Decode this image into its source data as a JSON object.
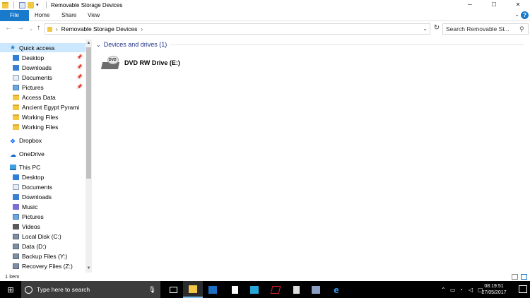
{
  "window": {
    "title": "Removable Storage Devices",
    "controls": {
      "minimize": "─",
      "maximize": "☐",
      "close": "✕"
    }
  },
  "ribbon": {
    "tabs": [
      "File",
      "Home",
      "Share",
      "View"
    ],
    "help": "?"
  },
  "navbar": {
    "back": "←",
    "forward": "→",
    "recent": "⌄",
    "up": "↑",
    "breadcrumb": "Removable Storage Devices",
    "search_placeholder": "Search Removable St..."
  },
  "sidebar": {
    "quick_access": "Quick access",
    "quick_items": [
      {
        "label": "Desktop",
        "pinned": true
      },
      {
        "label": "Downloads",
        "pinned": true
      },
      {
        "label": "Documents",
        "pinned": true
      },
      {
        "label": "Pictures",
        "pinned": true
      },
      {
        "label": "Access Data"
      },
      {
        "label": "Ancient Egypt Pyrami"
      },
      {
        "label": "Working Files"
      },
      {
        "label": "Working Files"
      }
    ],
    "dropbox": "Dropbox",
    "onedrive": "OneDrive",
    "this_pc": "This PC",
    "pc_items": [
      "Desktop",
      "Documents",
      "Downloads",
      "Music",
      "Pictures",
      "Videos",
      "Local Disk (C:)",
      "Data (D:)",
      "Backup Files (Y:)",
      "Recovery Files (Z:)"
    ]
  },
  "content": {
    "group_title": "Devices and drives (1)",
    "drives": [
      {
        "name": "DVD RW Drive (E:)",
        "badge": "DVD"
      }
    ]
  },
  "status": {
    "count": "1 item"
  },
  "taskbar": {
    "search_placeholder": "Type here to search",
    "time": "08:19:51",
    "date": "27/05/2017"
  }
}
